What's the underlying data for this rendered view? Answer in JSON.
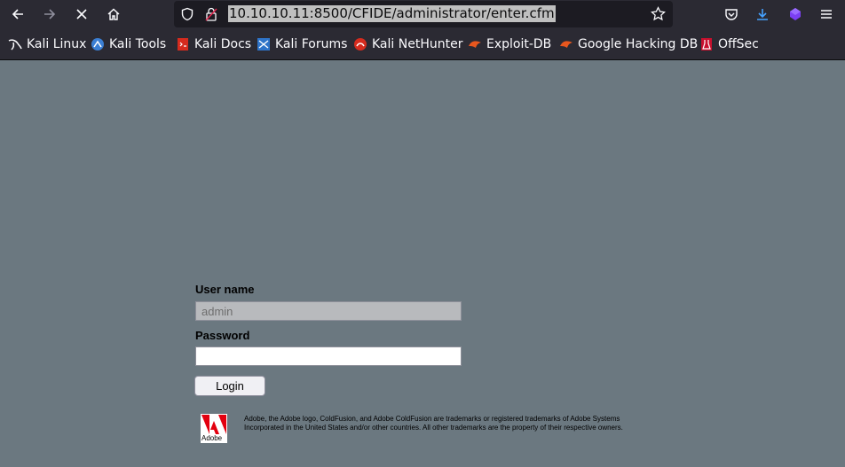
{
  "browser": {
    "url": "10.10.10.11:8500/CFIDE/administrator/enter.cfm",
    "bookmarks": [
      {
        "label": "Kali Linux",
        "icon": "kali-dragon-icon"
      },
      {
        "label": "Kali Tools",
        "icon": "kali-tools-icon"
      },
      {
        "label": "Kali Docs",
        "icon": "kali-docs-icon"
      },
      {
        "label": "Kali Forums",
        "icon": "kali-forums-icon"
      },
      {
        "label": "Kali NetHunter",
        "icon": "nethunter-icon"
      },
      {
        "label": "Exploit-DB",
        "icon": "exploit-db-icon"
      },
      {
        "label": "Google Hacking DB",
        "icon": "ghdb-icon"
      },
      {
        "label": "OffSec",
        "icon": "offsec-icon"
      }
    ]
  },
  "login": {
    "username_label": "User name",
    "username_value": "admin",
    "password_label": "Password",
    "password_value": "",
    "login_button": "Login"
  },
  "footer": {
    "logo_text": "Adobe",
    "legal": "Adobe, the Adobe logo, ColdFusion, and Adobe ColdFusion are trademarks or registered trademarks of Adobe Systems Incorporated in the United States and/or other countries. All other trademarks are the property of their respective owners."
  },
  "colors": {
    "page_background": "#6b7880",
    "browser_chrome": "#2b2a33",
    "adobe_red": "#e3000f"
  }
}
